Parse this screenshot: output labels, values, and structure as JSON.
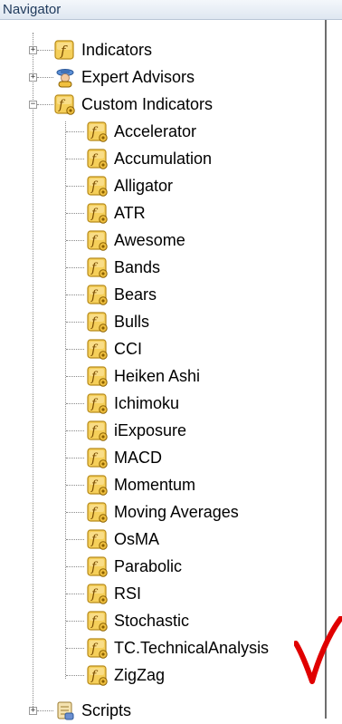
{
  "window": {
    "title": "Navigator"
  },
  "tree": {
    "indicators": "Indicators",
    "expert_advisors": "Expert Advisors",
    "custom_indicators": "Custom Indicators",
    "scripts": "Scripts",
    "custom": [
      "Accelerator",
      "Accumulation",
      "Alligator",
      "ATR",
      "Awesome",
      "Bands",
      "Bears",
      "Bulls",
      "CCI",
      "Heiken Ashi",
      "Ichimoku",
      "iExposure",
      "MACD",
      "Momentum",
      "Moving Averages",
      "OsMA",
      "Parabolic",
      "RSI",
      "Stochastic",
      "TC.TechnicalAnalysis",
      "ZigZag"
    ]
  },
  "colors": {
    "check_mark": "#e00000",
    "icon_fill": "#f3c74a",
    "icon_border": "#b78a1a"
  },
  "icons": {
    "folder": "indicator-icon",
    "advisor": "expert-advisor-icon",
    "script": "script-icon"
  }
}
